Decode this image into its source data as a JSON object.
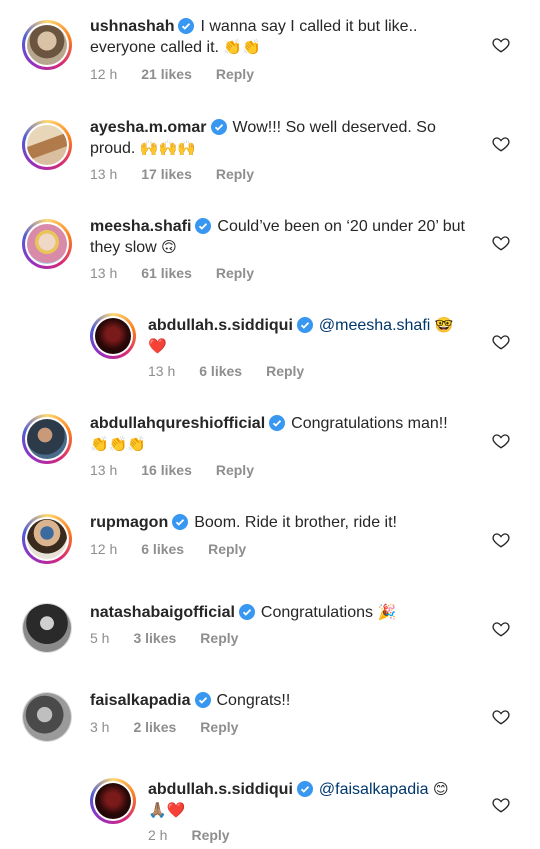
{
  "comments": [
    {
      "user": "ushnashah",
      "text": "I wanna say I called it but like.. everyone called it.",
      "emoji": "👏👏",
      "time": "12 h",
      "likes": "21 likes",
      "reply": "Reply"
    },
    {
      "user": "ayesha.m.omar",
      "text": "Wow!!! So well deserved. So proud.",
      "emoji": "🙌🙌🙌",
      "time": "13 h",
      "likes": "17 likes",
      "reply": "Reply"
    },
    {
      "user": "meesha.shafi",
      "text": "Could’ve been on ‘20 under 20’ but they slow",
      "emoji": "🙃",
      "time": "13 h",
      "likes": "61 likes",
      "reply": "Reply"
    },
    {
      "user": "abdullah.s.siddiqui",
      "mention": "@meesha.shafi",
      "emoji": "🤓 ❤️",
      "time": "13 h",
      "likes": "6 likes",
      "reply": "Reply"
    },
    {
      "user": "abdullahqureshiofficial",
      "text": "Congratulations man!!",
      "emoji": "👏👏👏",
      "time": "13 h",
      "likes": "16 likes",
      "reply": "Reply"
    },
    {
      "user": "rupmagon",
      "text": "Boom. Ride it brother, ride it!",
      "time": "12 h",
      "likes": "6 likes",
      "reply": "Reply"
    },
    {
      "user": "natashabaigofficial",
      "text": "Congratulations",
      "emoji": "🎉",
      "time": "5 h",
      "likes": "3 likes",
      "reply": "Reply"
    },
    {
      "user": "faisalkapadia",
      "text": "Congrats!!",
      "time": "3 h",
      "likes": "2 likes",
      "reply": "Reply"
    },
    {
      "user": "abdullah.s.siddiqui",
      "mention": "@faisalkapadia",
      "emoji": "😊 🙏🏽❤️",
      "time": "2 h",
      "reply": "Reply"
    }
  ],
  "colors": {
    "verified": "#3897f0",
    "text": "#262626",
    "meta": "#8e8e8e",
    "mention": "#00376b"
  }
}
